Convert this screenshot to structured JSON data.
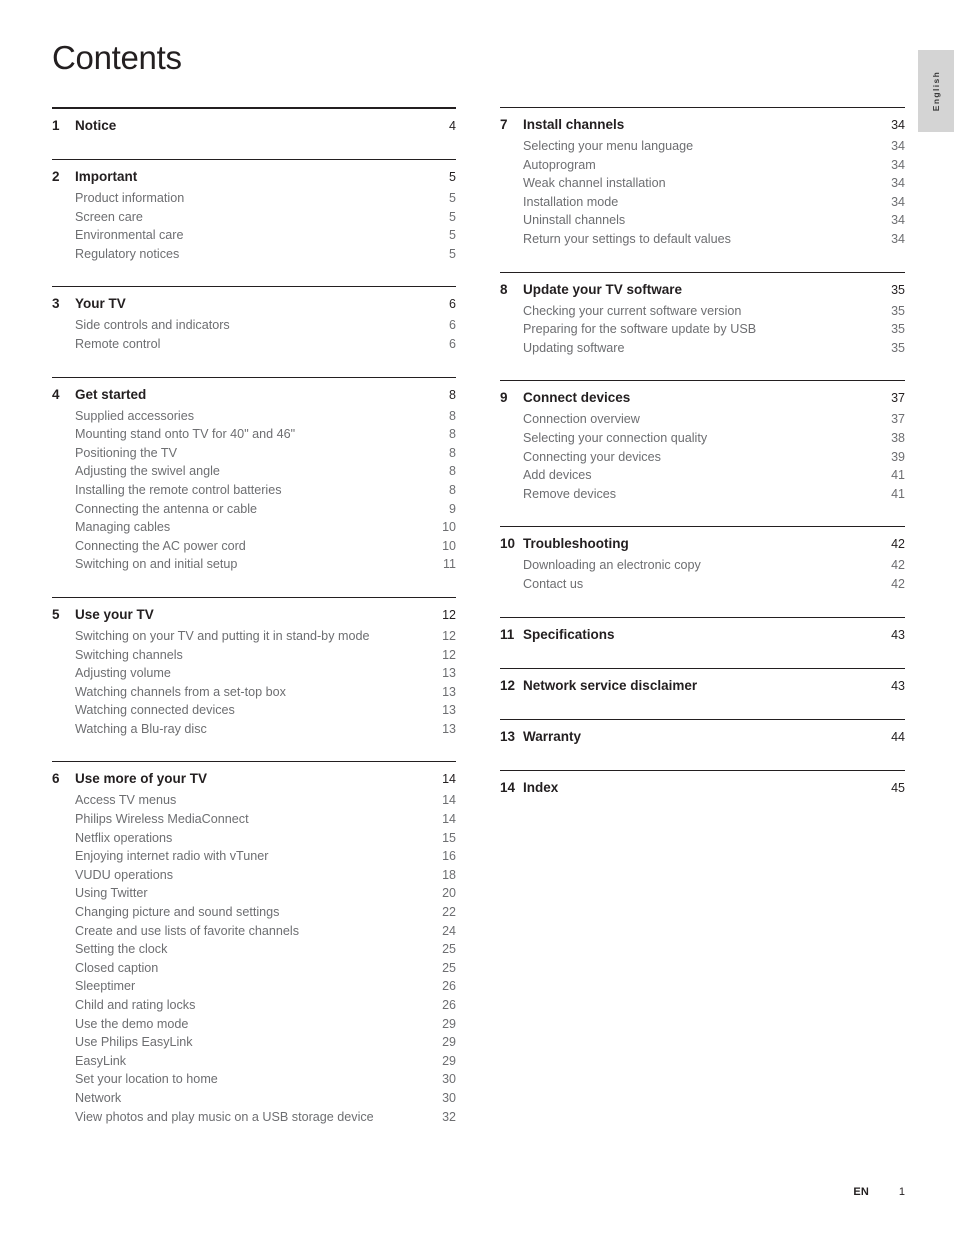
{
  "document": {
    "title": "Contents",
    "language_tab": "English",
    "footer": {
      "language_code": "EN",
      "page_number": "1"
    }
  },
  "columns": {
    "left": [
      {
        "number": "1",
        "title": "Notice",
        "page": "4",
        "rule": "thick",
        "items": []
      },
      {
        "number": "2",
        "title": "Important",
        "page": "5",
        "rule": "thin",
        "items": [
          {
            "label": "Product information",
            "page": "5"
          },
          {
            "label": "Screen care",
            "page": "5"
          },
          {
            "label": "Environmental care",
            "page": "5"
          },
          {
            "label": "Regulatory notices",
            "page": "5"
          }
        ]
      },
      {
        "number": "3",
        "title": "Your TV",
        "page": "6",
        "rule": "thin",
        "items": [
          {
            "label": "Side controls and indicators",
            "page": "6"
          },
          {
            "label": "Remote control",
            "page": "6"
          }
        ]
      },
      {
        "number": "4",
        "title": "Get started",
        "page": "8",
        "rule": "thin",
        "items": [
          {
            "label": "Supplied accessories",
            "page": "8"
          },
          {
            "label": "Mounting stand onto TV for 40\" and 46\"",
            "page": "8"
          },
          {
            "label": "Positioning the TV",
            "page": "8"
          },
          {
            "label": "Adjusting the swivel angle",
            "page": "8"
          },
          {
            "label": "Installing the remote control batteries",
            "page": "8"
          },
          {
            "label": "Connecting the antenna or cable",
            "page": "9"
          },
          {
            "label": "Managing cables",
            "page": "10"
          },
          {
            "label": "Connecting the AC power cord",
            "page": "10"
          },
          {
            "label": "Switching on and initial setup",
            "page": "11"
          }
        ]
      },
      {
        "number": "5",
        "title": "Use your TV",
        "page": "12",
        "rule": "thin",
        "items": [
          {
            "label": "Switching on your TV and putting it in stand-by mode",
            "page": "12"
          },
          {
            "label": "Switching channels",
            "page": "12"
          },
          {
            "label": "Adjusting volume",
            "page": "13"
          },
          {
            "label": "Watching channels from a set-top box",
            "page": "13"
          },
          {
            "label": "Watching connected devices",
            "page": "13"
          },
          {
            "label": "Watching a Blu-ray disc",
            "page": "13"
          }
        ]
      },
      {
        "number": "6",
        "title": "Use more of your TV",
        "page": "14",
        "rule": "thin",
        "items": [
          {
            "label": "Access TV menus",
            "page": "14"
          },
          {
            "label": "Philips Wireless MediaConnect",
            "page": "14"
          },
          {
            "label": "Netflix operations",
            "page": "15"
          },
          {
            "label": "Enjoying internet radio with vTuner",
            "page": "16"
          },
          {
            "label": "VUDU operations",
            "page": "18"
          },
          {
            "label": "Using Twitter",
            "page": "20"
          },
          {
            "label": "Changing picture and sound settings",
            "page": "22"
          },
          {
            "label": "Create and use lists of favorite channels",
            "page": "24"
          },
          {
            "label": "Setting the clock",
            "page": "25"
          },
          {
            "label": "Closed caption",
            "page": "25"
          },
          {
            "label": "Sleeptimer",
            "page": "26"
          },
          {
            "label": "Child and rating locks",
            "page": "26"
          },
          {
            "label": "Use the demo mode",
            "page": "29"
          },
          {
            "label": "Use Philips EasyLink",
            "page": "29"
          },
          {
            "label": "EasyLink",
            "page": "29"
          },
          {
            "label": "Set your location to home",
            "page": "30"
          },
          {
            "label": "Network",
            "page": "30"
          },
          {
            "label": "View photos and play music on a USB storage device",
            "page": "32"
          }
        ]
      }
    ],
    "right": [
      {
        "number": "7",
        "title": "Install channels",
        "page": "34",
        "rule": "thin",
        "items": [
          {
            "label": "Selecting your menu language",
            "page": "34"
          },
          {
            "label": "Autoprogram",
            "page": "34"
          },
          {
            "label": "Weak channel installation",
            "page": "34"
          },
          {
            "label": "Installation mode",
            "page": "34"
          },
          {
            "label": "Uninstall channels",
            "page": "34"
          },
          {
            "label": "Return your settings to default values",
            "page": "34"
          }
        ]
      },
      {
        "number": "8",
        "title": "Update your TV software",
        "page": "35",
        "rule": "thin",
        "items": [
          {
            "label": "Checking your current software version",
            "page": "35"
          },
          {
            "label": "Preparing for the software update by USB",
            "page": "35"
          },
          {
            "label": "Updating software",
            "page": "35"
          }
        ]
      },
      {
        "number": "9",
        "title": "Connect devices",
        "page": "37",
        "rule": "thin",
        "items": [
          {
            "label": "Connection overview",
            "page": "37"
          },
          {
            "label": "Selecting your connection quality",
            "page": "38"
          },
          {
            "label": "Connecting your devices",
            "page": "39"
          },
          {
            "label": "Add devices",
            "page": "41"
          },
          {
            "label": "Remove devices",
            "page": "41"
          }
        ]
      },
      {
        "number": "10",
        "title": "Troubleshooting",
        "page": "42",
        "rule": "thin",
        "items": [
          {
            "label": "Downloading an electronic copy",
            "page": "42"
          },
          {
            "label": "Contact us",
            "page": "42"
          }
        ]
      },
      {
        "number": "11",
        "title": "Specifications",
        "page": "43",
        "rule": "thin",
        "items": []
      },
      {
        "number": "12",
        "title": "Network service disclaimer",
        "page": "43",
        "rule": "thin",
        "items": []
      },
      {
        "number": "13",
        "title": "Warranty",
        "page": "44",
        "rule": "thin",
        "items": []
      },
      {
        "number": "14",
        "title": "Index",
        "page": "45",
        "rule": "thin",
        "items": []
      }
    ]
  }
}
